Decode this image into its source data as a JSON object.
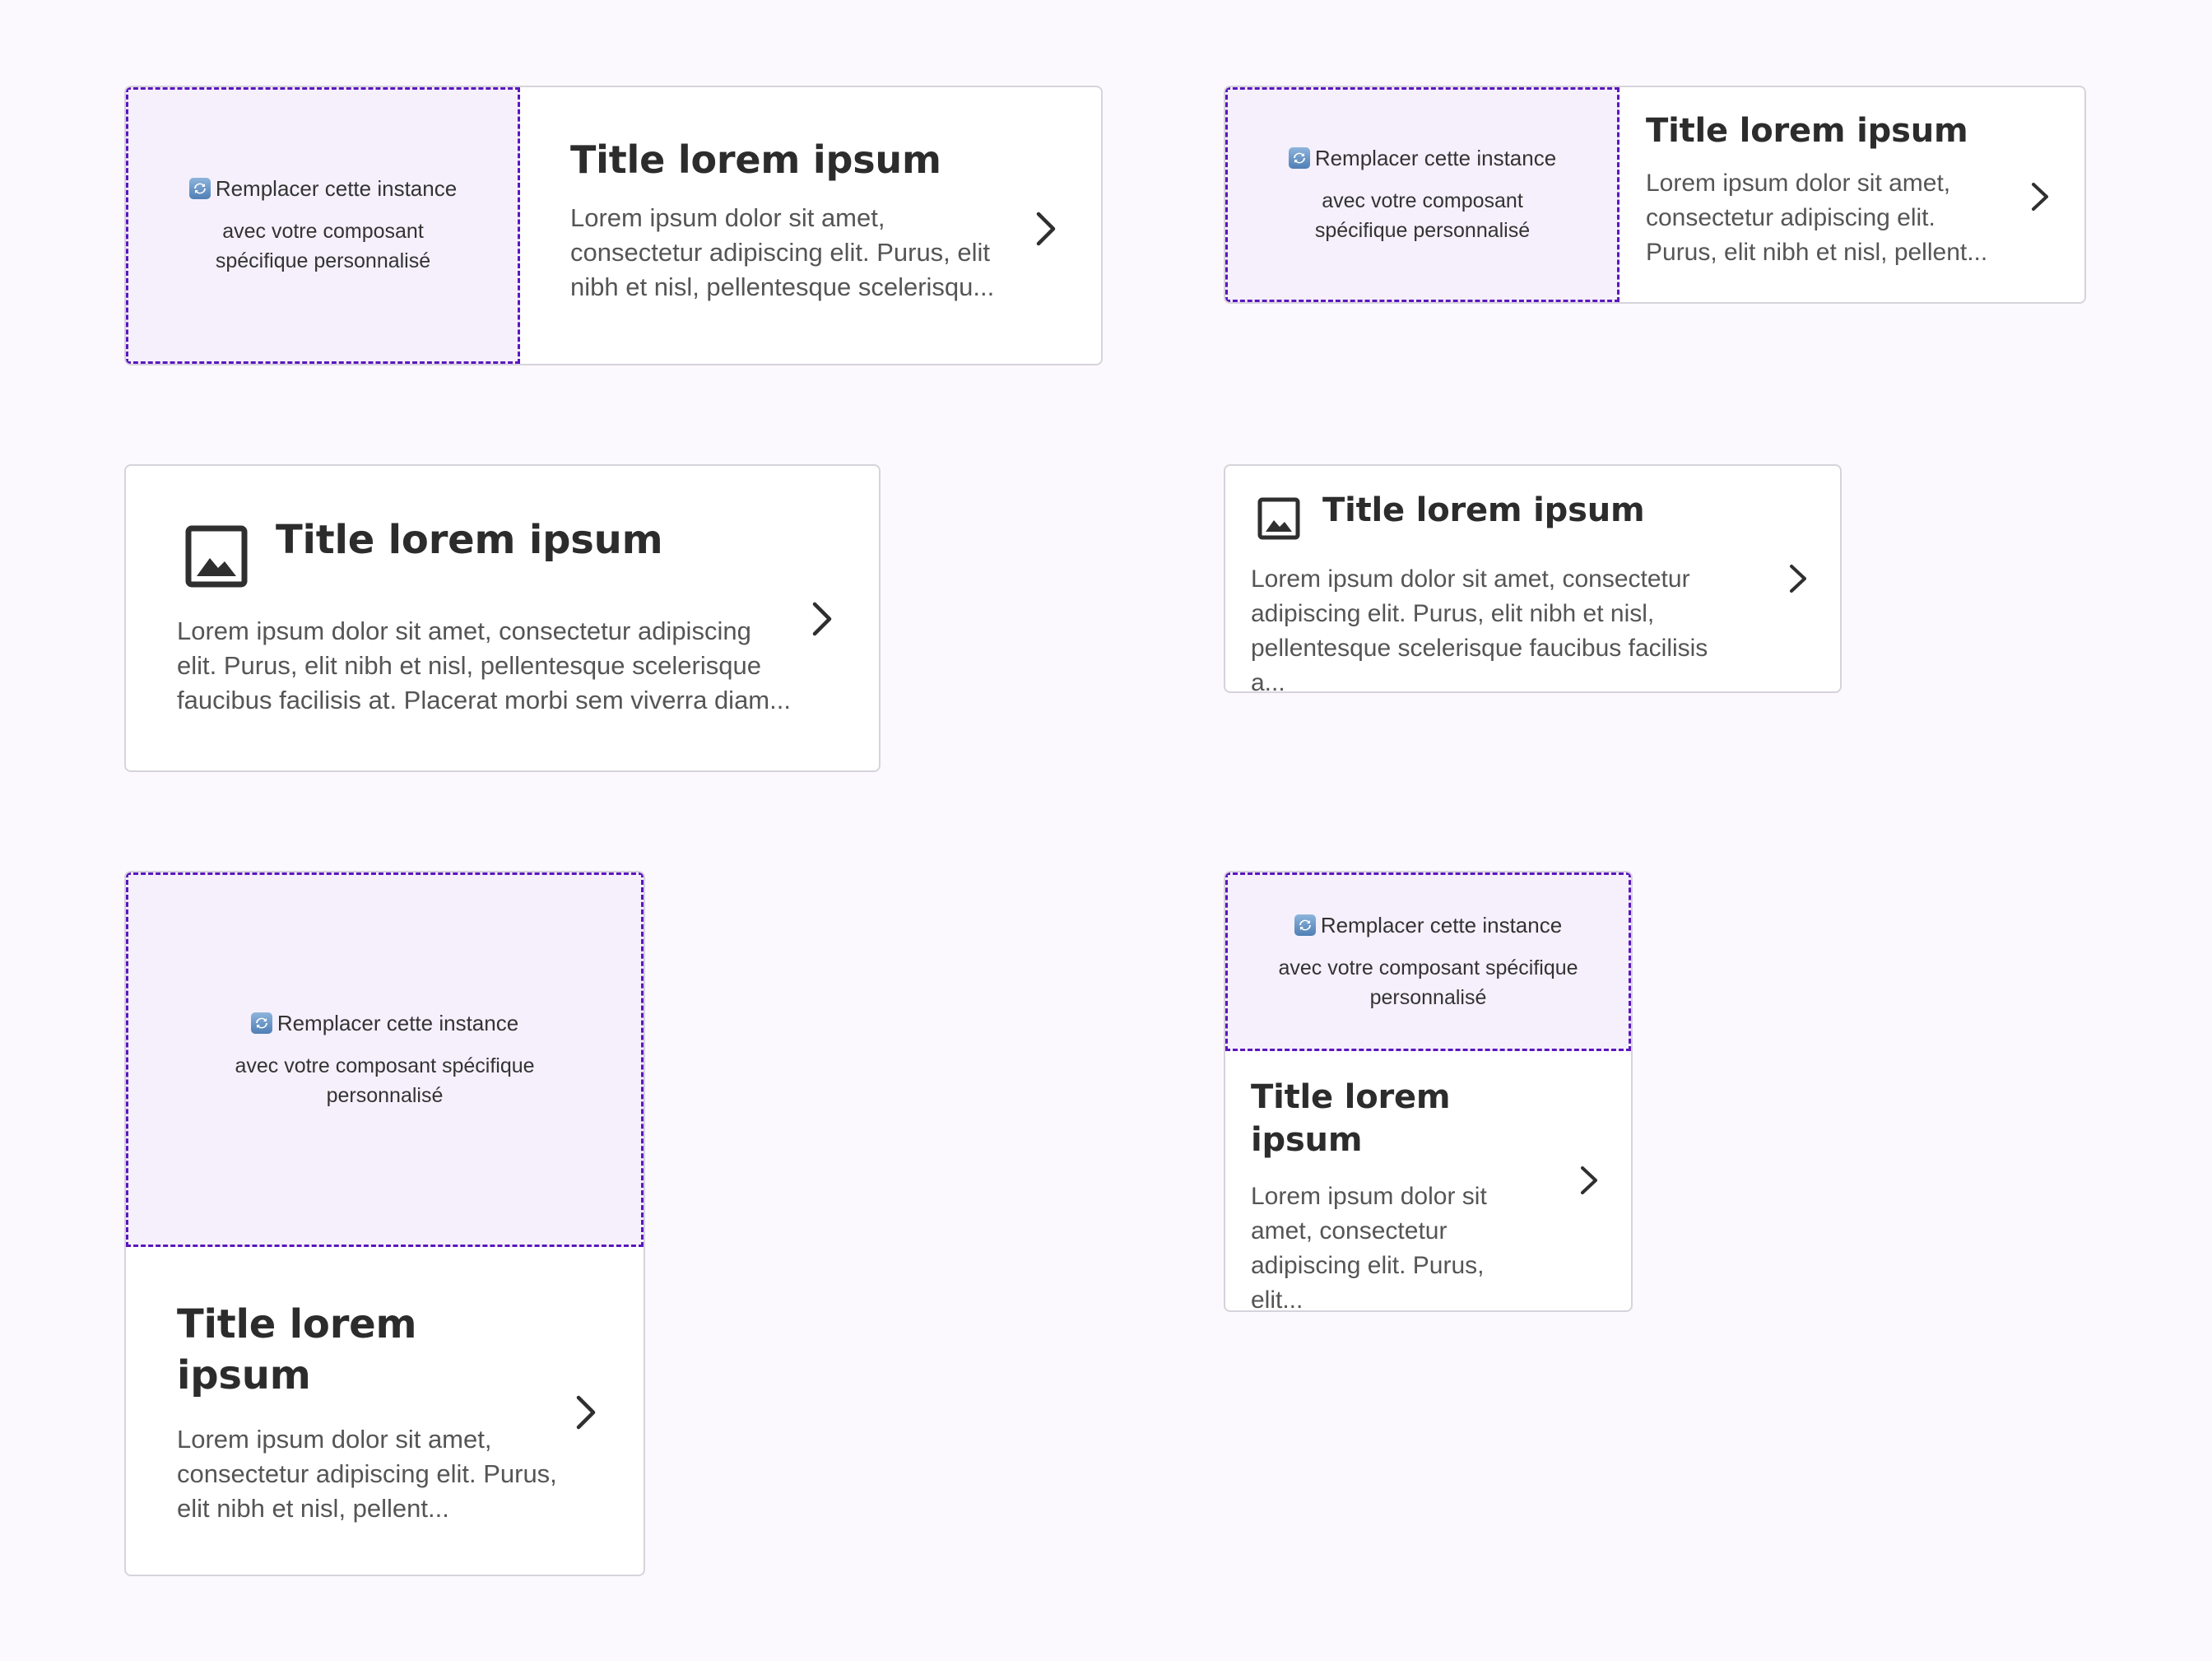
{
  "placeholder": {
    "line1": "Remplacer cette instance",
    "line2a": "avec votre composant",
    "line2b": "spécifique personnalisé",
    "line2c": "avec votre composant spécifique",
    "line2d": "personnalisé"
  },
  "cards": [
    {
      "title": "Title lorem ipsum",
      "description": "Lorem ipsum dolor sit amet, consectetur adipiscing elit. Purus, elit nibh et nisl, pellentesque scelerisqu..."
    },
    {
      "title": "Title lorem ipsum",
      "description": "Lorem ipsum dolor sit amet, consectetur adipiscing elit. Purus, elit nibh et nisl, pellent..."
    },
    {
      "title": "Title lorem ipsum",
      "description": "Lorem ipsum dolor sit amet, consectetur adipiscing elit. Purus, elit nibh et nisl, pellentesque scelerisque faucibus facilisis at. Placerat morbi sem viverra diam..."
    },
    {
      "title": "Title lorem ipsum",
      "description": "Lorem ipsum dolor sit amet, consectetur adipiscing elit. Purus, elit nibh et nisl, pellentesque scelerisque faucibus facilisis a..."
    },
    {
      "title": "Title lorem ipsum",
      "description": "Lorem ipsum dolor sit amet, consectetur adipiscing elit. Purus, elit nibh et nisl, pellent..."
    },
    {
      "title": "Title lorem ipsum",
      "description": "Lorem ipsum dolor sit amet, consectetur adipiscing elit. Purus, elit..."
    }
  ],
  "icons": {
    "placeholder_icon": "swap-icon",
    "image_icon": "image-icon",
    "navigation_icon": "chevron-right-icon"
  },
  "colors": {
    "background": "#fbf9fe",
    "card_border": "#d6d3dc",
    "placeholder_fill": "#f5f0fc",
    "placeholder_border": "#5b16bf",
    "title_text": "#2c2c2c",
    "body_text": "#555555"
  }
}
